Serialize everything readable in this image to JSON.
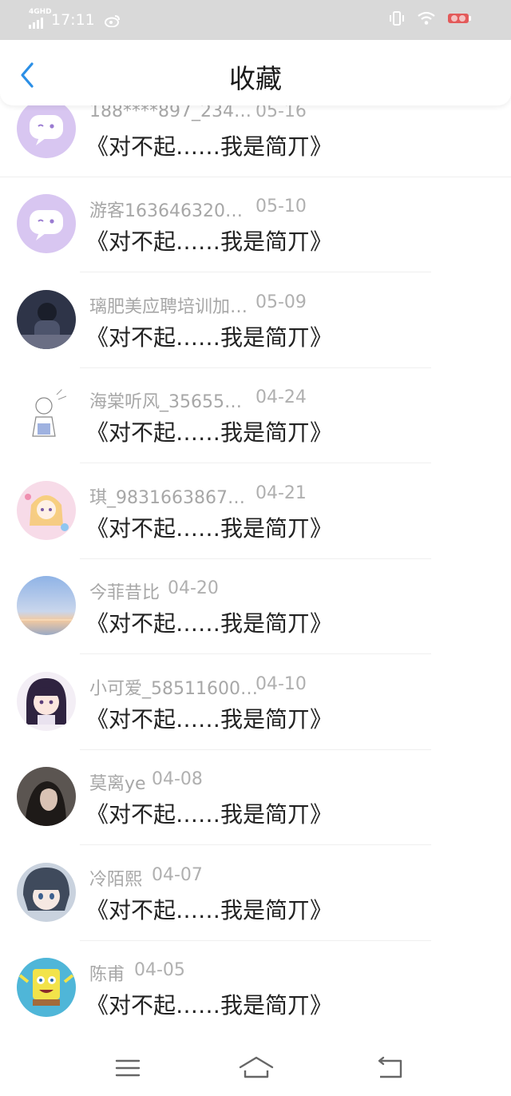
{
  "status_bar": {
    "network": "4GHD",
    "time": "17:11",
    "icons": [
      "signal-icon",
      "weibo-icon",
      "vibrate-icon",
      "wifi-icon",
      "battery-icon"
    ]
  },
  "header": {
    "title": "收藏",
    "back_icon": "chevron-left-icon"
  },
  "colors": {
    "accent": "#2b8fe6",
    "status_bar_bg": "#d9d9d9",
    "meta_text": "#a7a7a7",
    "title_text": "#222222"
  },
  "items": [
    {
      "user": "188****897_234…",
      "date": "05-16",
      "title": "《对不起……我是简丌》",
      "avatar": "chat-bubble-avatar"
    },
    {
      "user": "游客163646320…",
      "date": "05-10",
      "title": "《对不起……我是简丌》",
      "avatar": "chat-bubble-avatar"
    },
    {
      "user": "璃肥美应聘培训加…",
      "date": "05-09",
      "title": "《对不起……我是简丌》",
      "avatar": "photo-avatar"
    },
    {
      "user": "海棠听风_35655…",
      "date": "04-24",
      "title": "《对不起……我是简丌》",
      "avatar": "sketch-avatar"
    },
    {
      "user": "琪_9831663867…",
      "date": "04-21",
      "title": "《对不起……我是简丌》",
      "avatar": "anime-avatar"
    },
    {
      "user": "今菲昔比",
      "date": "04-20",
      "title": "《对不起……我是简丌》",
      "avatar": "sunset-avatar"
    },
    {
      "user": "小可爱_58511600…",
      "date": "04-10",
      "title": "《对不起……我是简丌》",
      "avatar": "anime-girl-avatar"
    },
    {
      "user": "莫离ye",
      "date": "04-08",
      "title": "《对不起……我是简丌》",
      "avatar": "portrait-avatar"
    },
    {
      "user": "冷陌熙",
      "date": "04-07",
      "title": "《对不起……我是简丌》",
      "avatar": "anime-boy-avatar"
    },
    {
      "user": "陈甫",
      "date": "04-05",
      "title": "《对不起……我是简丌》",
      "avatar": "spongebob-avatar"
    }
  ],
  "nav_bar": {
    "icons": [
      "menu-icon",
      "home-icon",
      "back-icon"
    ]
  }
}
